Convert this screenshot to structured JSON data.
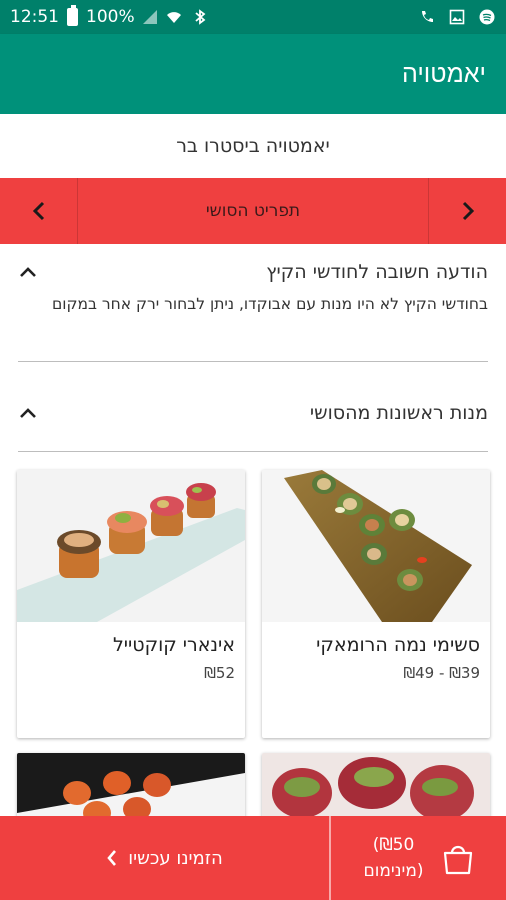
{
  "status_bar": {
    "time": "12:51",
    "battery_percent": "100%",
    "icons": [
      "battery-icon",
      "signal-icon",
      "wifi-icon",
      "bluetooth-icon",
      "call-icon",
      "image-icon",
      "spotify-icon"
    ]
  },
  "app_bar": {
    "title": "יאמטויה"
  },
  "restaurant": {
    "subtitle": "יאמטויה ביסטרו בר"
  },
  "category_nav": {
    "current": "תפריט הסושי",
    "prev_icon": "chevron-left-icon",
    "next_icon": "chevron-right-icon"
  },
  "notice": {
    "title": "הודעה חשובה לחודשי הקיץ",
    "body": "בחודשי הקיץ לא היו מנות עם אבוקדו, ניתן לבחור ירק אחר במקום"
  },
  "section": {
    "title": "מנות ראשונות מהסושי"
  },
  "items": [
    {
      "name": "סשימי נמה הרומאקי",
      "price": "₪39 - ₪49"
    },
    {
      "name": "אינארי קוקטייל",
      "price": "₪52"
    }
  ],
  "bottom_bar": {
    "order_label": "הזמינו עכשיו",
    "minimum_amount": "(₪50",
    "minimum_label": "מינימום)"
  },
  "colors": {
    "primary_green": "#00917a",
    "status_green": "#00806a",
    "accent_red": "#ef4040"
  }
}
